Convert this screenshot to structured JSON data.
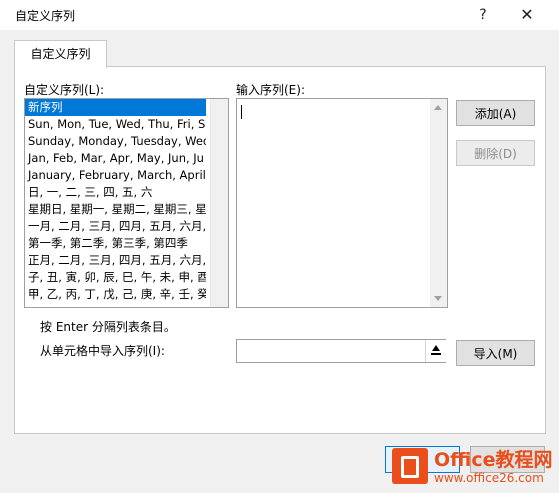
{
  "window": {
    "title": "自定义序列",
    "help_label": "?",
    "close_label": "✕"
  },
  "tab": {
    "label": "自定义序列"
  },
  "list": {
    "label": "自定义序列(L):",
    "items": [
      "新序列",
      "Sun, Mon, Tue, Wed, Thu, Fri, S",
      "Sunday, Monday, Tuesday, Wed",
      "Jan, Feb, Mar, Apr, May, Jun, Ju",
      "January, February, March, April,",
      "日, 一, 二, 三, 四, 五, 六",
      "星期日, 星期一, 星期二, 星期三, 星",
      "一月, 二月, 三月, 四月, 五月, 六月,",
      "第一季, 第二季, 第三季, 第四季",
      "正月, 二月, 三月, 四月, 五月, 六月,",
      "子, 丑, 寅, 卯, 辰, 巳, 午, 未, 申, 酉",
      "甲, 乙, 丙, 丁, 戊, 己, 庚, 辛, 壬, 癸"
    ],
    "selected_index": 0
  },
  "entries": {
    "label": "输入序列(E):",
    "value": ""
  },
  "buttons": {
    "add": "添加(A)",
    "delete": "删除(D)",
    "import": "导入(M)"
  },
  "hint": "按 Enter 分隔列表条目。",
  "import_label": "从单元格中导入序列(I):",
  "import_value": "",
  "watermark": {
    "line1": "Office教程网",
    "line2": "www.office26.com"
  },
  "colors": {
    "selection": "#0078d7",
    "watermark": "#e94e1b"
  }
}
